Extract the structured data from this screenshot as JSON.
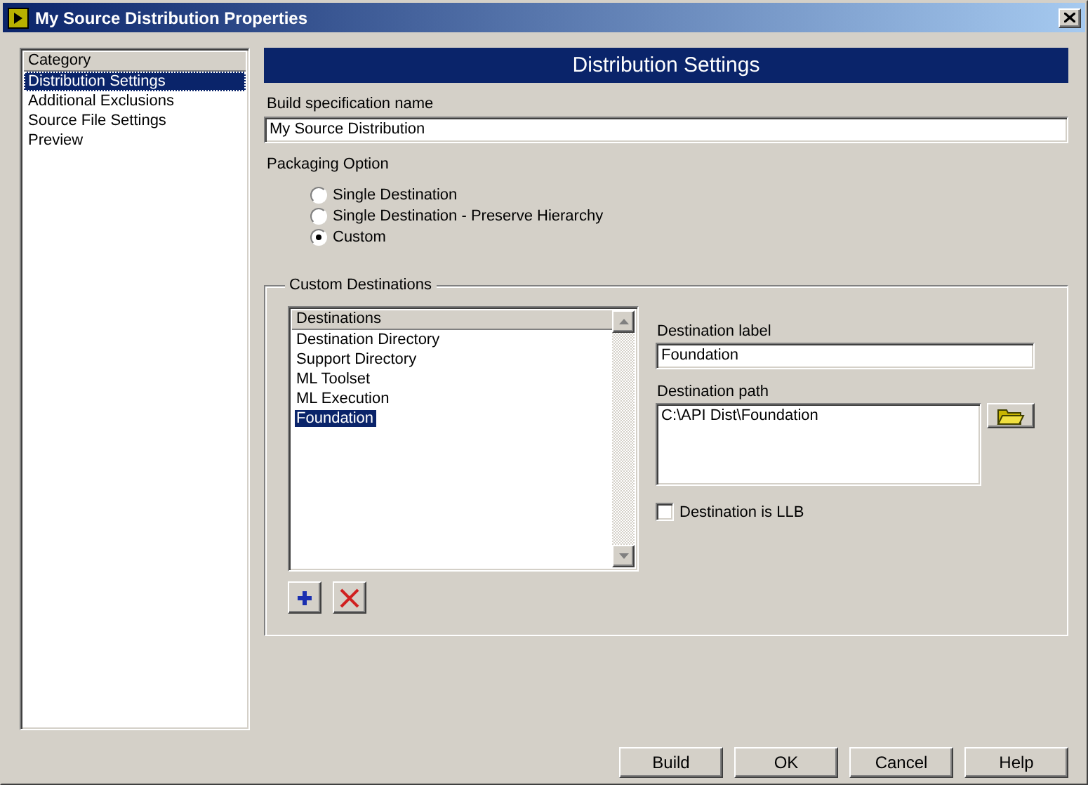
{
  "window": {
    "title": "My Source Distribution Properties"
  },
  "category_list": {
    "header": "Category",
    "items": [
      {
        "label": "Distribution Settings",
        "selected": true
      },
      {
        "label": "Additional Exclusions",
        "selected": false
      },
      {
        "label": "Source File Settings",
        "selected": false
      },
      {
        "label": "Preview",
        "selected": false
      }
    ]
  },
  "panel": {
    "title": "Distribution Settings"
  },
  "build_spec": {
    "label": "Build specification name",
    "value": "My Source Distribution"
  },
  "packaging": {
    "label": "Packaging Option",
    "options": [
      {
        "label": "Single Destination",
        "selected": false
      },
      {
        "label": "Single Destination - Preserve Hierarchy",
        "selected": false
      },
      {
        "label": "Custom",
        "selected": true
      }
    ]
  },
  "custom_destinations": {
    "title": "Custom Destinations",
    "list_header": "Destinations",
    "items": [
      {
        "label": "Destination Directory",
        "selected": false
      },
      {
        "label": "Support Directory",
        "selected": false
      },
      {
        "label": "ML Toolset",
        "selected": false
      },
      {
        "label": "ML Execution",
        "selected": false
      },
      {
        "label": "Foundation",
        "selected": true
      }
    ],
    "destination_label": {
      "label": "Destination label",
      "value": "Foundation"
    },
    "destination_path": {
      "label": "Destination path",
      "value": "C:\\API Dist\\Foundation"
    },
    "is_llb": {
      "label": "Destination is LLB",
      "checked": false
    }
  },
  "buttons": [
    "Build",
    "OK",
    "Cancel",
    "Help"
  ]
}
